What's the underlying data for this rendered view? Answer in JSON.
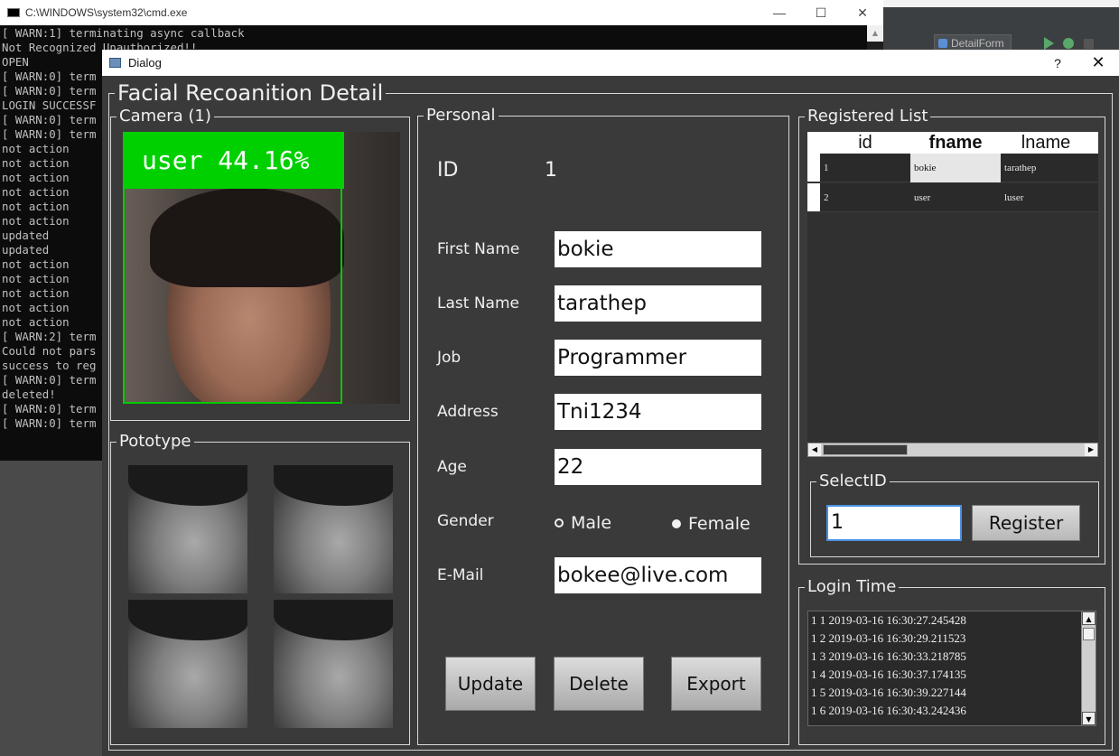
{
  "cmd": {
    "title": "C:\\WINDOWS\\system32\\cmd.exe",
    "minimize": "—",
    "maximize": "☐",
    "close": "✕",
    "lines": "[ WARN:1] terminating async callback\nNot Recognized Unauthorized!!\nOPEN\n[ WARN:0] term\n[ WARN:0] term\nLOGIN SUCCESSF\n[ WARN:0] term\n[ WARN:0] term\nnot action\nnot action\nnot action\nnot action\nnot action\nnot action\nupdated\nupdated\nnot action\nnot action\nnot action\nnot action\nnot action\n[ WARN:2] term\nCould not pars\nsuccess to reg\n[ WARN:0] term\ndeleted!\n[ WARN:0] term\n[ WARN:0] term"
  },
  "ide": {
    "config": "DetailForm",
    "dropdown_icon": "▾"
  },
  "dialog": {
    "title": "Dialog",
    "help": "?",
    "close": "✕",
    "main_group": "Facial Recoanition Detail",
    "camera": {
      "group": "Camera (1)",
      "label": "user 44.16%",
      "box_color": "#00cc00"
    },
    "prototype": {
      "group": "Pototype"
    },
    "personal": {
      "group": "Personal",
      "id_label": "ID",
      "id_value": "1",
      "first_name_label": "First Name",
      "first_name": "bokie",
      "last_name_label": "Last Name",
      "last_name": "tarathep",
      "job_label": "Job",
      "job": "Programmer",
      "address_label": "Address",
      "address": "Tni1234",
      "age_label": "Age",
      "age": "22",
      "gender_label": "Gender",
      "male": "Male",
      "female": "Female",
      "email_label": "E-Mail",
      "email": "bokee@live.com",
      "update": "Update",
      "delete": "Delete",
      "export": "Export"
    },
    "registered": {
      "group": "Registered List",
      "columns": [
        "id",
        "fname",
        "lname"
      ],
      "rows": [
        [
          "1",
          "bokie",
          "tarathep"
        ],
        [
          "2",
          "user",
          "luser"
        ]
      ],
      "scroll_left": "◀",
      "scroll_right": "▶"
    },
    "selectid": {
      "group": "SelectID",
      "value": "1",
      "register": "Register"
    },
    "login": {
      "group": "Login Time",
      "lines": [
        "1 1 2019-03-16 16:30:27.245428",
        "1 2 2019-03-16 16:30:29.211523",
        "1 3 2019-03-16 16:30:33.218785",
        "1 4 2019-03-16 16:30:37.174135",
        "1 5 2019-03-16 16:30:39.227144",
        "1 6 2019-03-16 16:30:43.242436"
      ],
      "scroll_up": "▲",
      "scroll_down": "▼"
    }
  }
}
